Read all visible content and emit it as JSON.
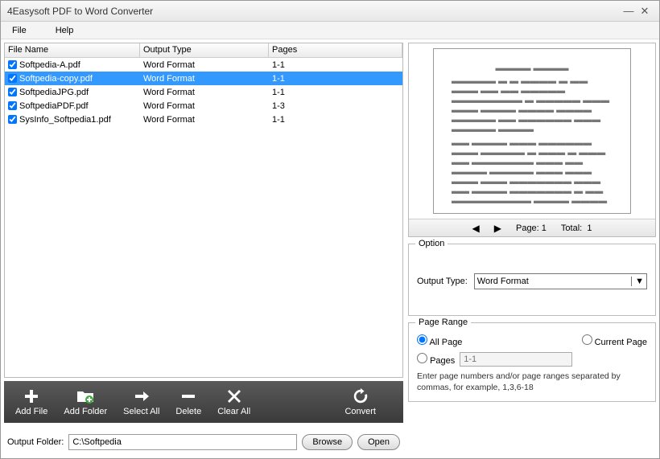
{
  "window": {
    "title": "4Easysoft PDF to Word Converter"
  },
  "menu": {
    "file": "File",
    "help": "Help"
  },
  "table": {
    "headers": {
      "file": "File Name",
      "output": "Output Type",
      "pages": "Pages"
    },
    "rows": [
      {
        "file": "Softpedia-A.pdf",
        "output": "Word Format",
        "pages": "1-1",
        "checked": true,
        "selected": false
      },
      {
        "file": "Softpedia-copy.pdf",
        "output": "Word Format",
        "pages": "1-1",
        "checked": true,
        "selected": true
      },
      {
        "file": "SoftpediaJPG.pdf",
        "output": "Word Format",
        "pages": "1-1",
        "checked": true,
        "selected": false
      },
      {
        "file": "SoftpediaPDF.pdf",
        "output": "Word Format",
        "pages": "1-3",
        "checked": true,
        "selected": false
      },
      {
        "file": "SysInfo_Softpedia1.pdf",
        "output": "Word Format",
        "pages": "1-1",
        "checked": true,
        "selected": false
      }
    ]
  },
  "toolbar": {
    "addFile": "Add File",
    "addFolder": "Add Folder",
    "selectAll": "Select All",
    "delete": "Delete",
    "clearAll": "Clear All",
    "convert": "Convert"
  },
  "output": {
    "label": "Output Folder:",
    "path": "C:\\Softpedia",
    "browse": "Browse",
    "open": "Open"
  },
  "preview": {
    "pageLabel": "Page:",
    "pageNum": "1",
    "totalLabel": "Total:",
    "totalNum": "1"
  },
  "option": {
    "legend": "Option",
    "typeLabel": "Output Type:",
    "typeValue": "Word Format"
  },
  "range": {
    "legend": "Page Range",
    "all": "All Page",
    "current": "Current Page",
    "pages": "Pages",
    "placeholder": "1-1",
    "hint": "Enter page numbers and/or page ranges separated by commas, for example, 1,3,6-18"
  }
}
